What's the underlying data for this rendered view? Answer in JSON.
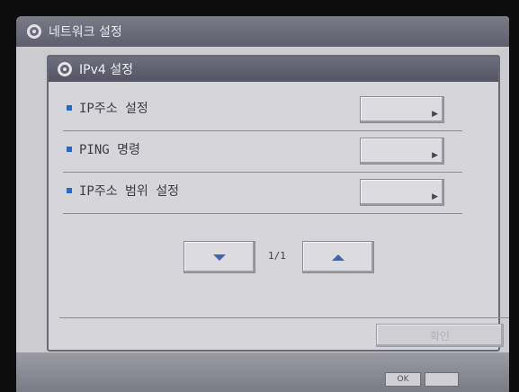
{
  "window": {
    "title": "네트워크 설정"
  },
  "panel": {
    "title": "IPv4 설정"
  },
  "menu": {
    "items": [
      {
        "label": "IP주소 설정"
      },
      {
        "label": "PING 명령"
      },
      {
        "label": "IP주소 범위 설정"
      }
    ]
  },
  "pager": {
    "indicator": "1/1"
  },
  "footer": {
    "ok_label": "확인"
  },
  "statusbar": {
    "chip_label": "OK"
  },
  "colors": {
    "bullet": "#2a68c8",
    "arrow": "#3e64ae",
    "titlebar": "#6e6e7c"
  }
}
